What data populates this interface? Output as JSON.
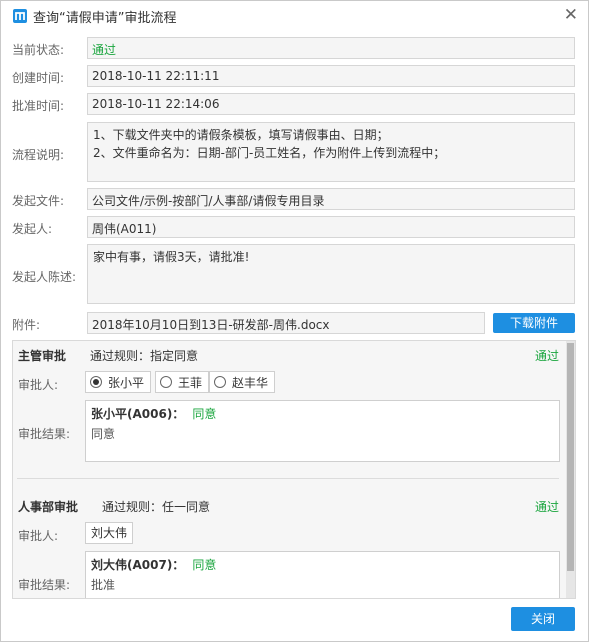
{
  "dialog": {
    "title": "查询“请假申请”审批流程",
    "icons": {
      "logo": "app-logo-icon",
      "close": "close-icon"
    }
  },
  "form": {
    "status_label": "当前状态:",
    "status_value": "通过",
    "created_label": "创建时间:",
    "created_value": "2018-10-11 22:11:11",
    "approved_label": "批准时间:",
    "approved_value": "2018-10-11 22:14:06",
    "process_label": "流程说明:",
    "process_lines": [
      "1、下载文件夹中的请假条模板，填写请假事由、日期；",
      "2、文件重命名为：日期-部门-员工姓名，作为附件上传到流程中；"
    ],
    "file_label": "发起文件:",
    "file_value": "公司文件/示例-按部门/人事部/请假专用目录",
    "initiator_label": "发起人:",
    "initiator_value": "周伟(A011)",
    "statement_label": "发起人陈述:",
    "statement_value": "家中有事，请假3天，请批准!",
    "attachment_label": "附件:",
    "attachment_value": "2018年10月10日到13日-研发部-周伟.docx",
    "download_label": "下载附件"
  },
  "approvals": [
    {
      "title": "主管审批",
      "rule": "通过规则：指定同意",
      "status": "通过",
      "approver_label": "审批人:",
      "approvers": [
        {
          "name": "张小平",
          "selected": true
        },
        {
          "name": "王菲",
          "selected": false
        },
        {
          "name": "赵丰华",
          "selected": false
        }
      ],
      "result_label": "审批结果:",
      "result_name": "张小平(A006)：",
      "result_flag": "同意",
      "result_comment": "同意"
    },
    {
      "title": "人事部审批",
      "rule": "通过规则：任一同意",
      "status": "通过",
      "approver_label": "审批人:",
      "approver": "刘大伟",
      "result_label": "审批结果:",
      "result_name": "刘大伟(A007)：",
      "result_flag": "同意",
      "result_comment": "批准"
    }
  ],
  "footer": {
    "close_label": "关闭"
  },
  "colors": {
    "accent": "#1e8fe1",
    "success": "#1aa53e"
  }
}
